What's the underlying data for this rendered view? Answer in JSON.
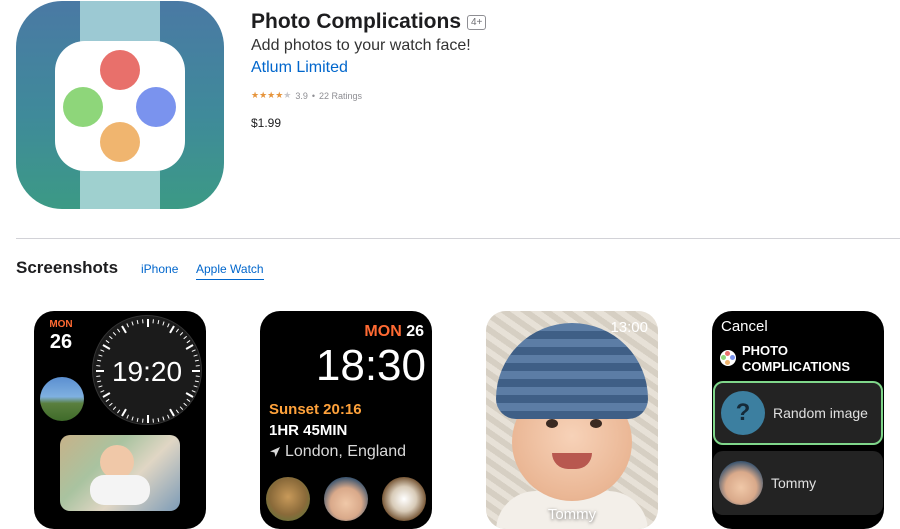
{
  "app": {
    "title": "Photo Complications",
    "age_rating": "4+",
    "subtitle": "Add photos to your watch face!",
    "developer": "Atlum Limited",
    "stars": 4,
    "rating_value": "3.9",
    "rating_separator": "•",
    "rating_count": "22 Ratings",
    "price": "$1.99",
    "icon": "watch-app-icon"
  },
  "screenshots": {
    "title": "Screenshots",
    "tabs": [
      "iPhone",
      "Apple Watch"
    ],
    "selected_tab": "Apple Watch",
    "shot1": {
      "day_label": "MON",
      "day_num": "26",
      "time": "19:20"
    },
    "shot2": {
      "day_label": "MON",
      "day_num": "26",
      "time": "18:30",
      "sunset": "Sunset 20:16",
      "day_length": "1HR 45MIN",
      "location": "London, England",
      "location_icon": "location-arrow-icon"
    },
    "shot3": {
      "time": "13:00",
      "name": "Tommy"
    },
    "shot4": {
      "cancel": "Cancel",
      "app_name": "PHOTO COMPLICATIONS",
      "option1_icon": "?",
      "option1": "Random image",
      "option2": "Tommy"
    }
  },
  "colors": {
    "link_blue": "#0066cc",
    "star_orange": "#e6943b",
    "watch_accent_orange": "#ff6a33",
    "sunset_orange": "#ffa23b",
    "selection_green": "#7fd68a"
  }
}
